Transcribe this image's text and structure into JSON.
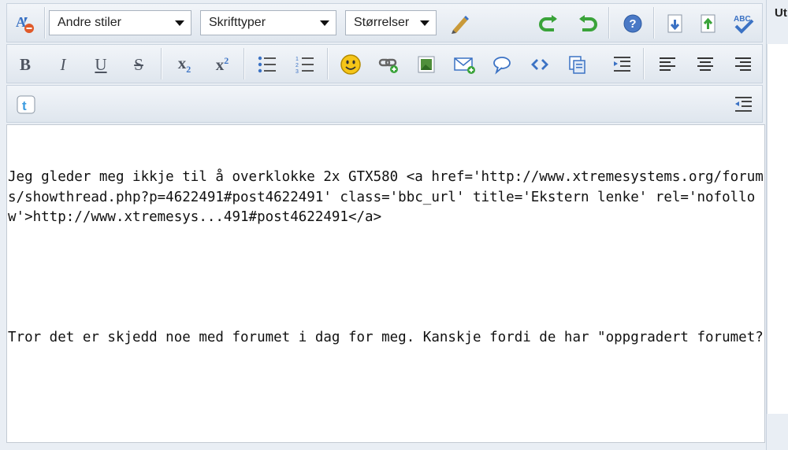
{
  "toolbar": {
    "style_select": "Andre stiler",
    "font_select": "Skrifttyper",
    "size_select": "Størrelser",
    "bold": "B",
    "italic": "I",
    "underline": "U",
    "strike": "S",
    "subscript_base": "x",
    "subscript_sup": "2",
    "superscript_base": "x",
    "superscript_sup": "2",
    "spell_label": "ABC"
  },
  "editor": {
    "paragraph1": "Jeg gleder meg ikkje til å overklokke 2x GTX580 <a href='http://www.xtremesystems.org/forums/showthread.php?p=4622491#post4622491' class='bbc_url' title='Ekstern lenke' rel='nofollow'>http://www.xtremesys...491#post4622491</a>",
    "paragraph2": "Tror det er skjedd noe med forumet i dag for meg. Kanskje fordi de har \"oppgradert forumet?"
  },
  "side_panel": {
    "header": "Ut"
  },
  "colors": {
    "toolbar_bg": "#e9eef4",
    "undo_green": "#3aa33a",
    "help_blue": "#4a79c6",
    "smiley_yellow": "#f5c518",
    "spell_underline": "#e05a5a"
  }
}
